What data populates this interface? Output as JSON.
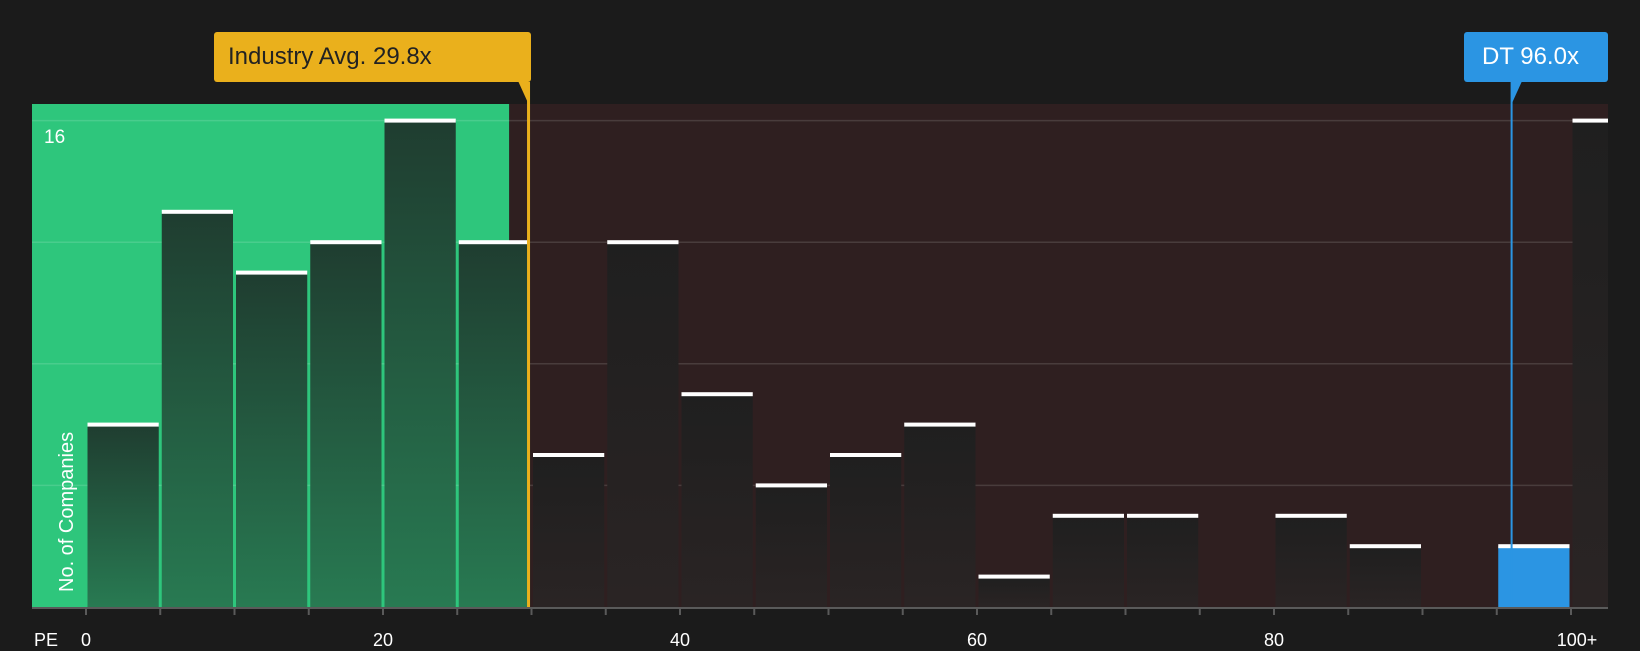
{
  "chart_data": {
    "type": "bar",
    "x_axis_name": "PE",
    "ylabel": "No. of Companies",
    "y_max_label": "16",
    "ylim": [
      0,
      16
    ],
    "xlim": [
      0,
      100
    ],
    "bin_width": 5,
    "x_ticks": [
      {
        "value": 0,
        "label": "0"
      },
      {
        "value": 20,
        "label": "20"
      },
      {
        "value": 40,
        "label": "40"
      },
      {
        "value": 60,
        "label": "60"
      },
      {
        "value": 80,
        "label": "80"
      },
      {
        "value": 100,
        "label": "100+"
      }
    ],
    "bins": [
      {
        "start": 0,
        "count": 6
      },
      {
        "start": 5,
        "count": 13
      },
      {
        "start": 10,
        "count": 11
      },
      {
        "start": 15,
        "count": 12
      },
      {
        "start": 20,
        "count": 16
      },
      {
        "start": 25,
        "count": 12
      },
      {
        "start": 30,
        "count": 5
      },
      {
        "start": 35,
        "count": 12
      },
      {
        "start": 40,
        "count": 7
      },
      {
        "start": 45,
        "count": 4
      },
      {
        "start": 50,
        "count": 5
      },
      {
        "start": 55,
        "count": 6
      },
      {
        "start": 60,
        "count": 1
      },
      {
        "start": 65,
        "count": 3
      },
      {
        "start": 70,
        "count": 3
      },
      {
        "start": 75,
        "count": 0
      },
      {
        "start": 80,
        "count": 3
      },
      {
        "start": 85,
        "count": 2
      },
      {
        "start": 90,
        "count": 0
      },
      {
        "start": 95,
        "count": 2
      },
      {
        "start": 100,
        "count": 16
      }
    ],
    "industry_avg": {
      "value": 29.8,
      "label": "Industry Avg. 29.8x"
    },
    "company": {
      "ticker": "DT",
      "value": 96.0,
      "label": "DT 96.0x"
    },
    "undervalued_until": 28.5,
    "colors": {
      "background": "#1b1b1b",
      "undervalued_zone": "#2ec67c",
      "overvalued_zone": "#2f1f20",
      "industry": "#eab01c",
      "company": "#2b95e3",
      "bar_dark": "#232323"
    }
  }
}
